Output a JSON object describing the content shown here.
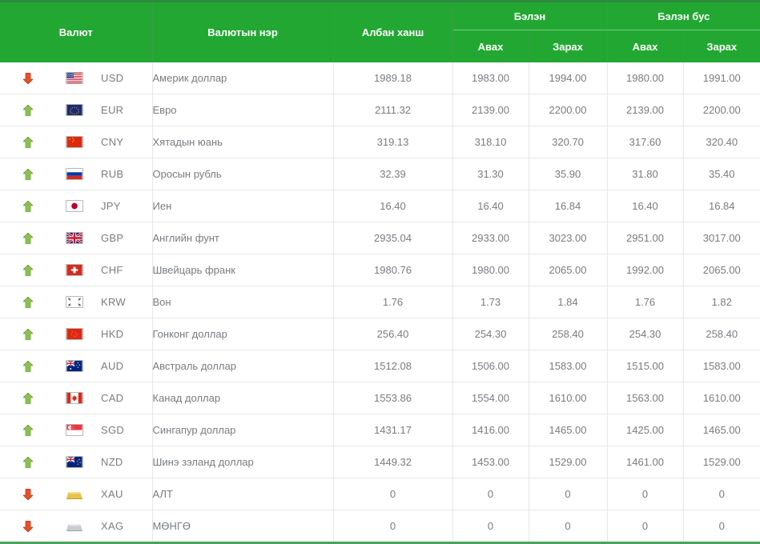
{
  "table": {
    "headers": {
      "currency": "Валют",
      "currency_name": "Валютын нэр",
      "official_rate": "Албан ханш",
      "cash_group": "Бэлэн",
      "noncash_group": "Бэлэн бус",
      "buy": "Авах",
      "sell": "Зарах"
    },
    "colors": {
      "header_green": "#22a832",
      "up_arrow_green": "#8cc152",
      "down_arrow_red": "#e84c23",
      "text_gray": "#777d82"
    },
    "rows": [
      {
        "trend": "down",
        "trend_icon": "arrow-down-red",
        "flag_icon": "flag-us",
        "code": "USD",
        "name": "Америк доллар",
        "official": "1989.18",
        "cash_buy": "1983.00",
        "cash_sell": "1994.00",
        "noncash_buy": "1980.00",
        "noncash_sell": "1991.00"
      },
      {
        "trend": "up",
        "trend_icon": "arrow-up-green",
        "flag_icon": "flag-eu",
        "code": "EUR",
        "name": "Евро",
        "official": "2111.32",
        "cash_buy": "2139.00",
        "cash_sell": "2200.00",
        "noncash_buy": "2139.00",
        "noncash_sell": "2200.00"
      },
      {
        "trend": "up",
        "trend_icon": "arrow-up-green",
        "flag_icon": "flag-cn",
        "code": "CNY",
        "name": "Хятадын юань",
        "official": "319.13",
        "cash_buy": "318.10",
        "cash_sell": "320.70",
        "noncash_buy": "317.60",
        "noncash_sell": "320.40"
      },
      {
        "trend": "up",
        "trend_icon": "arrow-up-green",
        "flag_icon": "flag-ru",
        "code": "RUB",
        "name": "Оросын рубль",
        "official": "32.39",
        "cash_buy": "31.30",
        "cash_sell": "35.90",
        "noncash_buy": "31.80",
        "noncash_sell": "35.40"
      },
      {
        "trend": "up",
        "trend_icon": "arrow-up-green",
        "flag_icon": "flag-jp",
        "code": "JPY",
        "name": "Иен",
        "official": "16.40",
        "cash_buy": "16.40",
        "cash_sell": "16.84",
        "noncash_buy": "16.40",
        "noncash_sell": "16.84"
      },
      {
        "trend": "up",
        "trend_icon": "arrow-up-green",
        "flag_icon": "flag-gb",
        "code": "GBP",
        "name": "Английн фунт",
        "official": "2935.04",
        "cash_buy": "2933.00",
        "cash_sell": "3023.00",
        "noncash_buy": "2951.00",
        "noncash_sell": "3017.00"
      },
      {
        "trend": "up",
        "trend_icon": "arrow-up-green",
        "flag_icon": "flag-ch",
        "code": "CHF",
        "name": "Швейцарь франк",
        "official": "1980.76",
        "cash_buy": "1980.00",
        "cash_sell": "2065.00",
        "noncash_buy": "1992.00",
        "noncash_sell": "2065.00"
      },
      {
        "trend": "up",
        "trend_icon": "arrow-up-green",
        "flag_icon": "flag-kr",
        "code": "KRW",
        "name": "Вон",
        "official": "1.76",
        "cash_buy": "1.73",
        "cash_sell": "1.84",
        "noncash_buy": "1.76",
        "noncash_sell": "1.82"
      },
      {
        "trend": "up",
        "trend_icon": "arrow-up-green",
        "flag_icon": "flag-hk",
        "code": "HKD",
        "name": "Гонконг доллар",
        "official": "256.40",
        "cash_buy": "254.30",
        "cash_sell": "258.40",
        "noncash_buy": "254.30",
        "noncash_sell": "258.40"
      },
      {
        "trend": "up",
        "trend_icon": "arrow-up-green",
        "flag_icon": "flag-au",
        "code": "AUD",
        "name": "Австраль доллар",
        "official": "1512.08",
        "cash_buy": "1506.00",
        "cash_sell": "1583.00",
        "noncash_buy": "1515.00",
        "noncash_sell": "1583.00"
      },
      {
        "trend": "up",
        "trend_icon": "arrow-up-green",
        "flag_icon": "flag-ca",
        "code": "CAD",
        "name": "Канад доллар",
        "official": "1553.86",
        "cash_buy": "1554.00",
        "cash_sell": "1610.00",
        "noncash_buy": "1563.00",
        "noncash_sell": "1610.00"
      },
      {
        "trend": "up",
        "trend_icon": "arrow-up-green",
        "flag_icon": "flag-sg",
        "code": "SGD",
        "name": "Сингапур доллар",
        "official": "1431.17",
        "cash_buy": "1416.00",
        "cash_sell": "1465.00",
        "noncash_buy": "1425.00",
        "noncash_sell": "1465.00"
      },
      {
        "trend": "up",
        "trend_icon": "arrow-up-green",
        "flag_icon": "flag-nz",
        "code": "NZD",
        "name": "Шинэ зэланд доллар",
        "official": "1449.32",
        "cash_buy": "1453.00",
        "cash_sell": "1529.00",
        "noncash_buy": "1461.00",
        "noncash_sell": "1529.00"
      },
      {
        "trend": "down",
        "trend_icon": "arrow-down-red",
        "flag_icon": "gold-bar",
        "code": "XAU",
        "name": "АЛТ",
        "official": "0",
        "cash_buy": "0",
        "cash_sell": "0",
        "noncash_buy": "0",
        "noncash_sell": "0"
      },
      {
        "trend": "down",
        "trend_icon": "arrow-down-red",
        "flag_icon": "silver-bar",
        "code": "XAG",
        "name": "МӨНГӨ",
        "official": "0",
        "cash_buy": "0",
        "cash_sell": "0",
        "noncash_buy": "0",
        "noncash_sell": "0"
      }
    ]
  }
}
